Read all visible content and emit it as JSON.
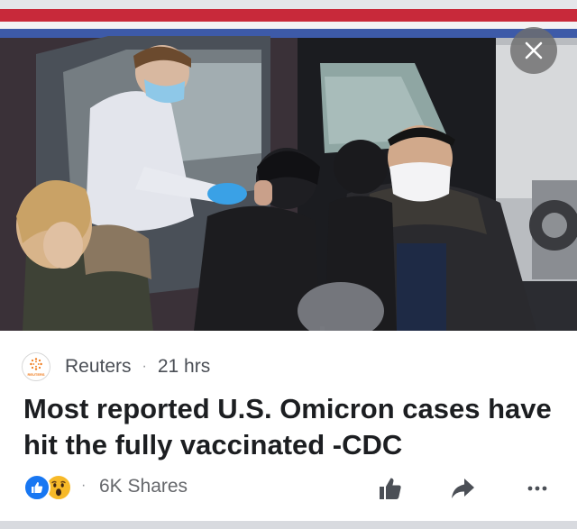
{
  "post": {
    "source_name": "Reuters",
    "logo_text": "REUTERS",
    "separator": "·",
    "time_ago": "21 hrs",
    "headline": "Most reported U.S. Omicron cases have hit the fully vaccinated -CDC"
  },
  "engagement": {
    "reactions": [
      "like-icon",
      "wow-icon"
    ],
    "separator": "·",
    "shares_text": "6K Shares"
  },
  "actions": {
    "close_icon": "close-icon",
    "like_icon": "thumbs-up-icon",
    "share_icon": "share-arrow-icon",
    "more_icon": "more-icon"
  },
  "colors": {
    "brand_blue": "#1877f2",
    "reuters_orange": "#f07a1a",
    "text_primary": "#1c1e21",
    "text_secondary": "#65676b"
  }
}
